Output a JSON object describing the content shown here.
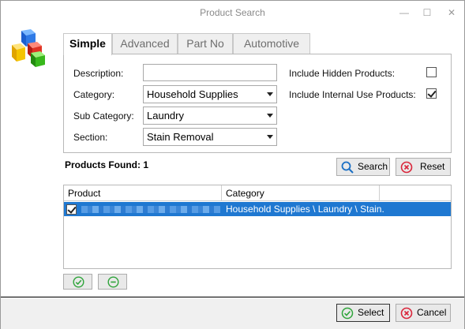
{
  "window": {
    "title": "Product Search",
    "minimize_glyph": "—",
    "maximize_glyph": "☐",
    "close_glyph": "✕"
  },
  "app_icon": "colored-blocks-icon",
  "tabs": [
    {
      "label": "Simple",
      "active": true
    },
    {
      "label": "Advanced",
      "active": false
    },
    {
      "label": "Part No",
      "active": false
    },
    {
      "label": "Automotive",
      "active": false
    }
  ],
  "form": {
    "description_label": "Description:",
    "description_value": "",
    "category_label": "Category:",
    "category_value": "Household Supplies",
    "subcategory_label": "Sub Category:",
    "subcategory_value": "Laundry",
    "section_label": "Section:",
    "section_value": "Stain Removal",
    "include_hidden_label": "Include Hidden Products:",
    "include_hidden_checked": false,
    "include_internal_label": "Include Internal Use Products:",
    "include_internal_checked": true
  },
  "results": {
    "found_label": "Products Found: 1",
    "search_button": "Search",
    "reset_button": "Reset",
    "columns": [
      "Product",
      "Category",
      ""
    ],
    "rows": [
      {
        "checked": true,
        "product": "",
        "category": "Household Supplies \\ Laundry \\ Stain..."
      }
    ]
  },
  "footer": {
    "select_button": "Select",
    "cancel_button": "Cancel"
  },
  "colors": {
    "selection": "#1f78d1",
    "green": "#2ea43a",
    "red": "#d9253a",
    "blue": "#1a6fc4"
  }
}
